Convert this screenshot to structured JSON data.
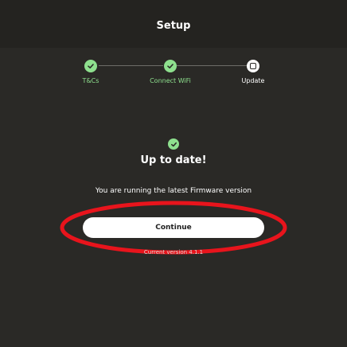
{
  "header": {
    "title": "Setup"
  },
  "stepper": {
    "steps": [
      {
        "label": "T&Cs",
        "state": "complete",
        "icon": "check-icon"
      },
      {
        "label": "Connect WiFi",
        "state": "complete",
        "icon": "check-icon"
      },
      {
        "label": "Update",
        "state": "current",
        "icon": "square-icon"
      }
    ]
  },
  "status": {
    "icon": "check-icon",
    "title": "Up to date!",
    "message": "You are running the latest Firmware version"
  },
  "actions": {
    "continue_label": "Continue"
  },
  "footer": {
    "version_text": "Current version 4.1.1"
  },
  "colors": {
    "background": "#2a2926",
    "header_background": "#242320",
    "accent_green": "#8ee08e",
    "highlight_red": "#e8141c",
    "button_background": "#ffffff"
  }
}
